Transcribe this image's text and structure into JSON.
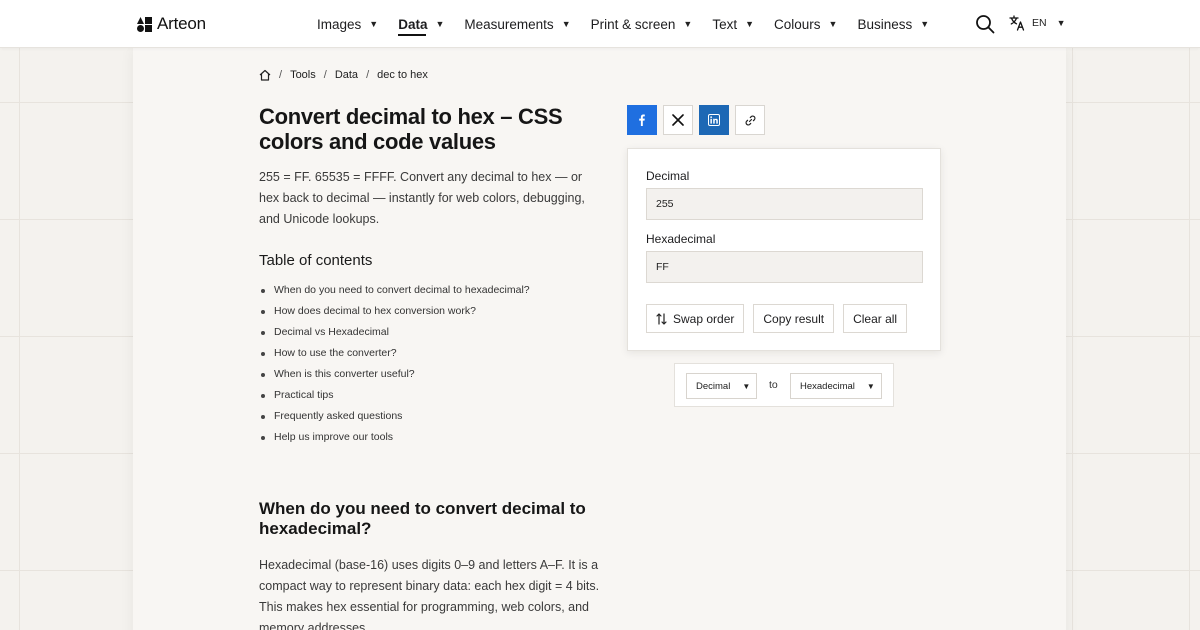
{
  "header": {
    "logo_text": "Arteon",
    "nav": [
      {
        "label": "Images",
        "active": false
      },
      {
        "label": "Data",
        "active": true
      },
      {
        "label": "Measurements",
        "active": false
      },
      {
        "label": "Print & screen",
        "active": false
      },
      {
        "label": "Text",
        "active": false
      },
      {
        "label": "Colours",
        "active": false
      },
      {
        "label": "Business",
        "active": false
      }
    ],
    "language": "EN",
    "icons": [
      "logo-mark",
      "search-icon",
      "translate-icon",
      "chevron-down-icon"
    ]
  },
  "breadcrumb": {
    "items": [
      "Tools",
      "Data",
      "dec to hex"
    ],
    "separator": "/"
  },
  "article": {
    "title": "Convert decimal to hex – CSS colors and code values",
    "intro": "255 = FF. 65535 = FFFF. Convert any decimal to hex — or hex back to decimal — instantly for web colors, debugging, and Unicode lookups.",
    "toc_title": "Table of contents",
    "toc": [
      "When do you need to convert decimal to hexadecimal?",
      "How does decimal to hex conversion work?",
      "Decimal vs Hexadecimal",
      "How to use the converter?",
      "When is this converter useful?",
      "Practical tips",
      "Frequently asked questions",
      "Help us improve our tools"
    ],
    "section_title": "When do you need to convert decimal to hexadecimal?",
    "section_text": "Hexadecimal (base-16) uses digits 0–9 and letters A–F. It is a compact way to represent binary data: each hex digit = 4 bits. This makes hex essential for programming, web colors, and memory addresses."
  },
  "share": {
    "buttons": [
      "facebook",
      "x",
      "linkedin",
      "copy-link"
    ],
    "colors": {
      "facebook": "#1f6fe0",
      "linkedin": "#1d68b5",
      "x": "#111111"
    }
  },
  "converter": {
    "decimal_label": "Decimal",
    "decimal_value": "255",
    "hex_label": "Hexadecimal",
    "hex_value": "FF",
    "swap_label": "Swap order",
    "copy_label": "Copy result",
    "clear_label": "Clear all"
  },
  "units": {
    "from": "Decimal",
    "to_word": "to",
    "to": "Hexadecimal"
  }
}
